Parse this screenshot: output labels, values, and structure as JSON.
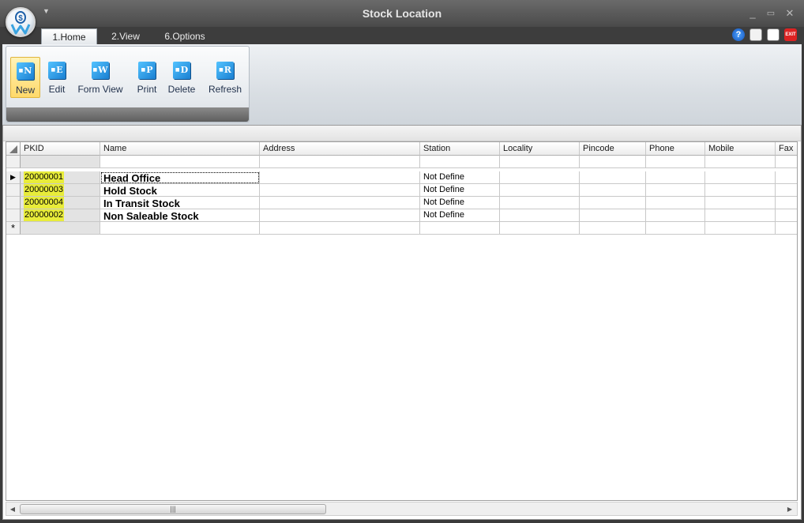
{
  "window": {
    "title": "Stock Location"
  },
  "tabs": [
    {
      "label": "1.Home"
    },
    {
      "label": "2.View"
    },
    {
      "label": "6.Options"
    }
  ],
  "ribbon": {
    "buttons": [
      {
        "label": "New",
        "icon_letter": "N",
        "icon": "new-icon"
      },
      {
        "label": "Edit",
        "icon_letter": "E",
        "icon": "edit-icon"
      },
      {
        "label": "Form View",
        "icon_letter": "W",
        "icon": "form-view-icon"
      },
      {
        "label": "Print",
        "icon_letter": "P",
        "icon": "print-icon"
      },
      {
        "label": "Delete",
        "icon_letter": "D",
        "icon": "delete-icon"
      },
      {
        "label": "Refresh",
        "icon_letter": "R",
        "icon": "refresh-icon"
      }
    ]
  },
  "grid": {
    "columns": [
      "PKID",
      "Name",
      "Address",
      "Station",
      "Locality",
      "Pincode",
      "Phone",
      "Mobile",
      "Fax"
    ],
    "rows": [
      {
        "pkid": "20000001",
        "name": "Head Office",
        "address": "",
        "station": "Not Define"
      },
      {
        "pkid": "20000003",
        "name": "Hold Stock",
        "address": "",
        "station": "Not Define"
      },
      {
        "pkid": "20000004",
        "name": "In Transit Stock",
        "address": "",
        "station": "Not Define"
      },
      {
        "pkid": "20000002",
        "name": "Non Saleable Stock",
        "address": "",
        "station": "Not Define"
      }
    ],
    "new_row_marker": "*",
    "current_row_marker": "▶"
  },
  "colors": {
    "highlight": "#e8ec3a",
    "accent": "#1a7fd1"
  }
}
